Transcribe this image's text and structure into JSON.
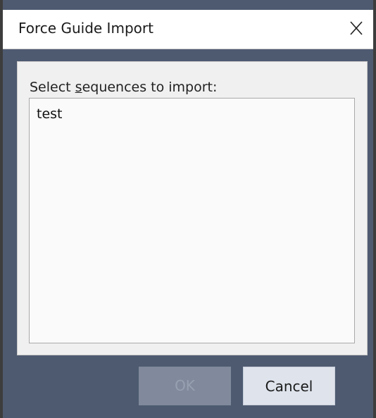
{
  "window": {
    "title": "Force Guide Import",
    "close_icon": "close-icon"
  },
  "content": {
    "list_label": "Select sequences to import:",
    "list_label_mnemonic": "s",
    "sequences": [
      "test"
    ]
  },
  "buttons": {
    "ok_label": "OK",
    "ok_enabled": false,
    "cancel_label": "Cancel"
  },
  "colors": {
    "frame_background": "#4e5a70",
    "panel_background": "#f0f0f0",
    "ok_disabled_fill": "#808a9c",
    "cancel_fill": "#dee3ec"
  }
}
